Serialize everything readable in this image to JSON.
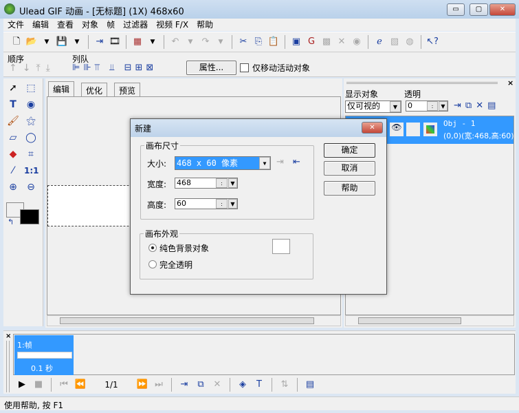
{
  "window": {
    "title": "Ulead GIF 动画 - [无标题] (1X) 468x60",
    "minimize": "▭",
    "maximize": "▢",
    "close": "✕"
  },
  "menu": [
    "文件",
    "编辑",
    "查看",
    "对象",
    "帧",
    "过滤器",
    "视频 F/X",
    "帮助"
  ],
  "toolbar2": {
    "order_label": "顺序",
    "queue_label": "列队",
    "properties_button": "属性...",
    "move_active_only": "仅移动活动对象"
  },
  "document": {
    "tabs": [
      "编辑",
      "优化",
      "预览"
    ]
  },
  "object_panel": {
    "show_label": "显示对象",
    "show_value": "仅可视的",
    "opacity_label": "透明",
    "opacity_value": "0",
    "object_name": "Obj - 1",
    "object_info": "(0,0)(宽:468,高:60)"
  },
  "dialog": {
    "title": "新建",
    "canvas_size_group": "画布尺寸",
    "size_label": "大小:",
    "size_value": "468 x 60 像素",
    "width_label": "宽度:",
    "width_value": "468",
    "height_label": "高度:",
    "height_value": "60",
    "ok": "确定",
    "cancel": "取消",
    "help": "帮助",
    "appearance_group": "画布外观",
    "solid_bg": "纯色背景对象",
    "transparent": "完全透明"
  },
  "frames": {
    "frame_label": "1:帧",
    "frame_delay": "0.1 秒",
    "counter": "1/1"
  },
  "status": "使用帮助, 按 F1"
}
